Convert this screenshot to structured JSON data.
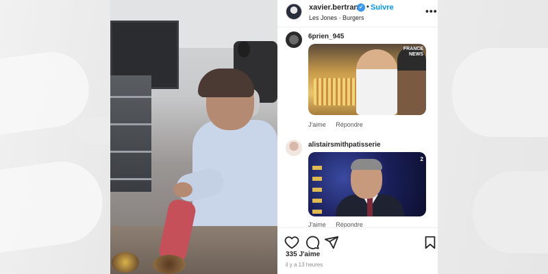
{
  "header": {
    "username": "xavier.bertrand",
    "verified_mark": "✓",
    "separator": "•",
    "follow_label": "Suivre",
    "location": "Les Jones · Burgers",
    "more_label": "•••"
  },
  "comments": [
    {
      "username": "6prien_945",
      "media_logo_line1": "FRANCE",
      "media_logo_line2": "NEWS",
      "like_label": "J'aime",
      "reply_label": "Répondre"
    },
    {
      "username": "alistairsmithpatisserie",
      "media_badge": "2",
      "like_label": "J'aime",
      "reply_label": "Répondre"
    }
  ],
  "actions": {
    "icons": [
      "heart-icon",
      "comment-icon",
      "share-icon",
      "bookmark-icon"
    ]
  },
  "likes_text": "335 J'aime",
  "time_text": "il y a 13 heures",
  "colors": {
    "accent": "#0095f6",
    "verified": "#3897f0",
    "text": "#262626",
    "muted": "#8e8e8e"
  }
}
